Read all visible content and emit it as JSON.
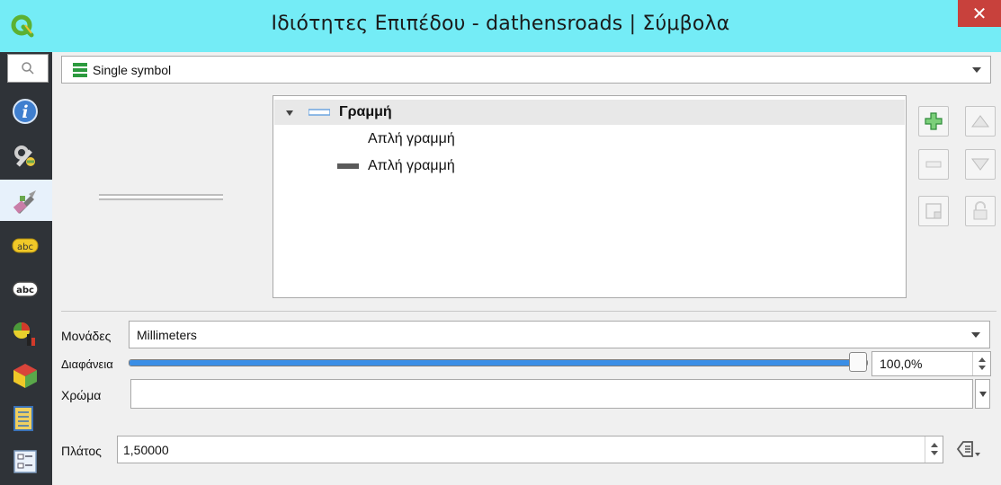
{
  "window": {
    "title": "Ιδιότητες Επιπέδου - dathensroads | Σύμβολα",
    "close_glyph": "✕"
  },
  "sidebar": {
    "items": [
      {
        "icon": "info-icon"
      },
      {
        "icon": "source-settings-icon"
      },
      {
        "icon": "symbology-brush-icon",
        "active": true
      },
      {
        "icon": "labels-icon",
        "text": "abc"
      },
      {
        "icon": "masks-icon",
        "text": "abc"
      },
      {
        "icon": "diagrams-icon"
      },
      {
        "icon": "3d-view-icon"
      },
      {
        "icon": "fields-icon"
      },
      {
        "icon": "attributes-form-icon"
      }
    ]
  },
  "renderer": {
    "type_label": "Single symbol"
  },
  "symbol_tree": {
    "root": {
      "label": "Γραμμή",
      "expanded": true
    },
    "layers": [
      {
        "label": "Απλή γραμμή",
        "swatch": "#ffffff"
      },
      {
        "label": "Απλή γραμμή",
        "swatch": "#5a5a5a"
      }
    ]
  },
  "properties": {
    "units_label": "Μονάδες",
    "units_value": "Millimeters",
    "opacity_label": "Διαφάνεια",
    "opacity_value": "100,0%",
    "opacity_fraction": 1.0,
    "color_label": "Χρώμα",
    "width_label": "Πλάτος",
    "width_value": "1,50000"
  },
  "colors": {
    "titlebar": "#74ecf6",
    "close": "#c8413c",
    "sidebar": "#2f3338",
    "slider": "#3a8ee6",
    "tree_selection": "#e8e8e8"
  }
}
